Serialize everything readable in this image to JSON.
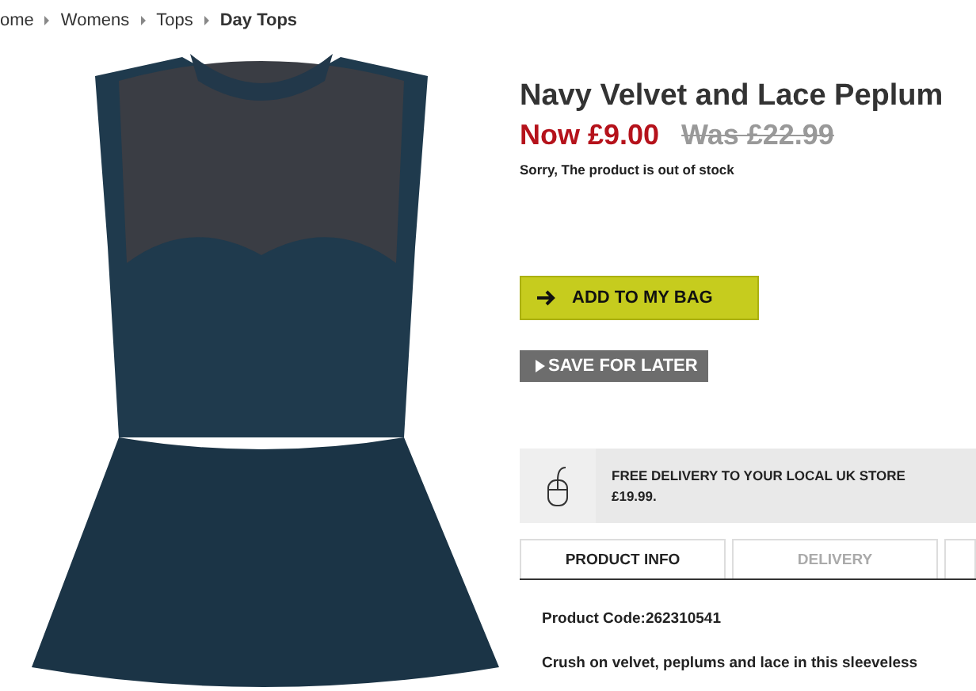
{
  "breadcrumb": [
    {
      "label": "ome",
      "current": false
    },
    {
      "label": "Womens",
      "current": false
    },
    {
      "label": "Tops",
      "current": false
    },
    {
      "label": "Day Tops",
      "current": true
    }
  ],
  "product": {
    "title": "Navy Velvet and Lace Peplum",
    "now_price": "Now £9.00",
    "was_price": "Was £22.99",
    "stock_message": "Sorry, The product is out of stock"
  },
  "buttons": {
    "add_to_bag": "ADD TO MY BAG",
    "save_for_later": "SAVE FOR LATER"
  },
  "delivery_banner": {
    "line_1": "FREE DELIVERY TO YOUR LOCAL UK STORE",
    "line_2": "£19.99."
  },
  "tabs": [
    {
      "label": "PRODUCT INFO",
      "selected": true
    },
    {
      "label": "DELIVERY",
      "selected": false
    }
  ],
  "product_info": {
    "code": "Product Code:262310541",
    "description": "Crush on velvet, peplums and lace in this sleeveless"
  }
}
